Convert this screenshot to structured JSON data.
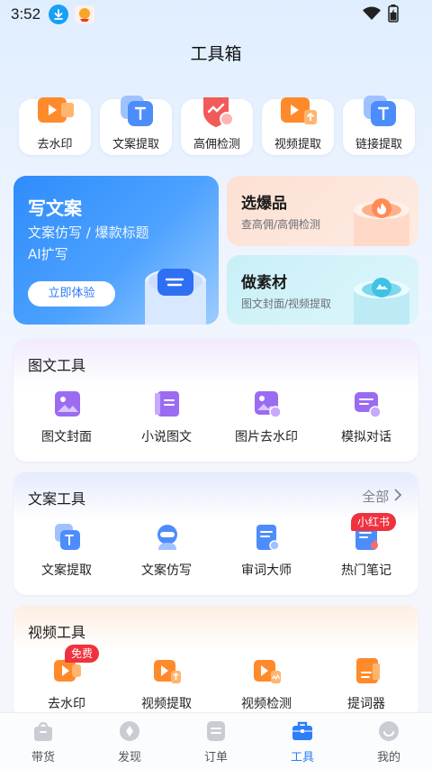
{
  "status_bar": {
    "time": "3:52"
  },
  "header": {
    "title": "工具箱"
  },
  "quick_tools": [
    {
      "label": "去水印",
      "icon": "video-play-icon"
    },
    {
      "label": "文案提取",
      "icon": "text-stack-icon"
    },
    {
      "label": "高佣检测",
      "icon": "trend-shield-icon"
    },
    {
      "label": "视频提取",
      "icon": "video-upload-icon"
    },
    {
      "label": "链接提取",
      "icon": "link-stack-icon"
    }
  ],
  "promo": {
    "write": {
      "title": "写文案",
      "line1": "文案仿写 / 爆款标题",
      "line2": "AI扩写",
      "button": "立即体验"
    },
    "explosive": {
      "title": "选爆品",
      "subtitle": "查高佣/高佣检测"
    },
    "material": {
      "title": "做素材",
      "subtitle": "图文封面/视频提取"
    }
  },
  "sections": {
    "image_text": {
      "title": "图文工具",
      "items": [
        {
          "label": "图文封面",
          "icon": "image-cover-icon"
        },
        {
          "label": "小说图文",
          "icon": "book-icon"
        },
        {
          "label": "图片去水印",
          "icon": "image-eraser-icon"
        },
        {
          "label": "模拟对话",
          "icon": "chat-icon"
        }
      ]
    },
    "copy": {
      "title": "文案工具",
      "more": "全部",
      "items": [
        {
          "label": "文案提取",
          "icon": "text-stack-icon"
        },
        {
          "label": "文案仿写",
          "icon": "robot-icon"
        },
        {
          "label": "审词大师",
          "icon": "doc-search-icon"
        },
        {
          "label": "热门笔记",
          "icon": "fire-note-icon",
          "tag": "小红书"
        }
      ]
    },
    "video": {
      "title": "视频工具",
      "items": [
        {
          "label": "去水印",
          "icon": "video-play-icon",
          "tag": "免费"
        },
        {
          "label": "视频提取",
          "icon": "video-upload-icon"
        },
        {
          "label": "视频检测",
          "icon": "video-wave-icon"
        },
        {
          "label": "提词器",
          "icon": "prompter-icon"
        }
      ]
    }
  },
  "bottom_nav": [
    {
      "label": "带货",
      "icon": "bag-icon"
    },
    {
      "label": "发现",
      "icon": "compass-icon"
    },
    {
      "label": "订单",
      "icon": "order-icon"
    },
    {
      "label": "工具",
      "icon": "toolbox-icon",
      "active": true
    },
    {
      "label": "我的",
      "icon": "profile-icon"
    }
  ],
  "colors": {
    "accent": "#2d7ef7",
    "tag_red": "#f0323f",
    "orange": "#ff8a2b",
    "blue": "#4d8dfb",
    "purple": "#9b6cf2"
  }
}
